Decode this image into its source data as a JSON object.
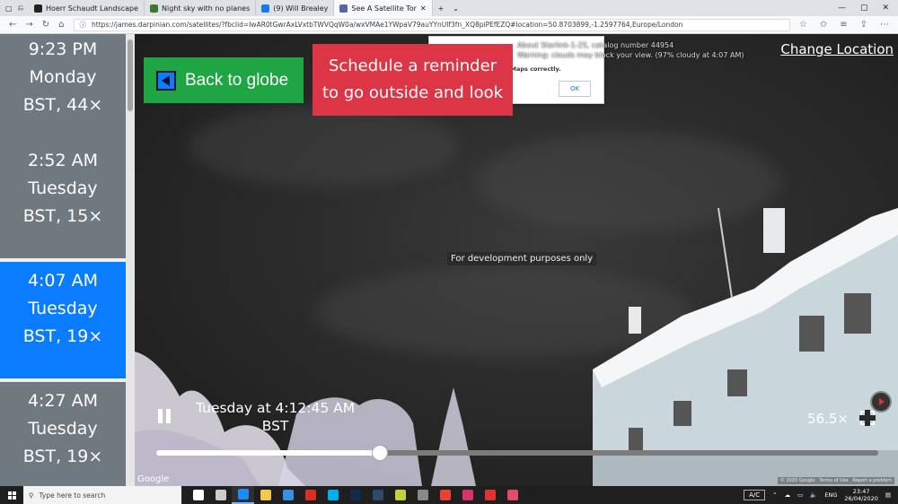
{
  "browser": {
    "tabs": [
      {
        "title": "Hoerr Schaudt Landscape",
        "color": "#222222"
      },
      {
        "title": "Night sky with no planes",
        "color": "#3a7a2a"
      },
      {
        "title": "(9) Will Brealey",
        "color": "#1877f2"
      },
      {
        "title": "See A Satellite Tor",
        "color": "#5566aa",
        "active": true
      }
    ],
    "url": "https://james.darpinian.com/satellites/?fbclid=IwAR0tGwrAxLVxtbTWVQqW0a/wxVMAe1YWpaV79auYYnUlf3fn_XQ8piPEfEZQ#location=50.8703899,-1.2597764,Europe/London"
  },
  "times": [
    {
      "time": "9:23 PM",
      "day": "Monday",
      "zone": "BST, 44×"
    },
    {
      "time": "2:52 AM",
      "day": "Tuesday",
      "zone": "BST, 15×"
    },
    {
      "time": "4:07 AM",
      "day": "Tuesday",
      "zone": "BST, 19×",
      "selected": true
    },
    {
      "time": "4:27 AM",
      "day": "Tuesday",
      "zone": "BST, 19×"
    }
  ],
  "buttons": {
    "back": "Back to globe",
    "remind_line1": "Schedule a reminder",
    "remind_line2": "to go outside and look",
    "change_location": "Change Location"
  },
  "satellite_info": {
    "line1": "About Starlink-1-25, catalog number 44954",
    "line2": "Warning: clouds may block your view. (97% cloudy at 4:07 AM)"
  },
  "dialog": {
    "message": "gle Maps correctly.",
    "ok_label": "OK"
  },
  "sky": {
    "dev_label": "For development purposes only"
  },
  "playback": {
    "time_line1": "Tuesday at 4:12:45 AM",
    "time_line2": "BST",
    "zoom": "56.5×",
    "progress": 0.31
  },
  "map_footer": {
    "google": "Google",
    "copyright": "© 2020 Google",
    "terms": "Terms of Use",
    "report": "Report a problem"
  },
  "taskbar": {
    "search_placeholder": "Type here to search",
    "ac": "A/C",
    "lang": "ENG",
    "time": "23:47",
    "date": "26/04/2020",
    "apps": [
      {
        "name": "task-view",
        "color": "#ffffff"
      },
      {
        "name": "multitask",
        "color": "#cccccc"
      },
      {
        "name": "edge",
        "color": "#1a8cff",
        "active": true
      },
      {
        "name": "files",
        "color": "#f2c94c"
      },
      {
        "name": "mail",
        "color": "#3a8ee6"
      },
      {
        "name": "autocad",
        "color": "#d93025"
      },
      {
        "name": "skype",
        "color": "#00aff0"
      },
      {
        "name": "photoshop",
        "color": "#0f2c4c"
      },
      {
        "name": "lightroom",
        "color": "#2d4a6b"
      },
      {
        "name": "stack",
        "color": "#c5d13a"
      },
      {
        "name": "calculator",
        "color": "#888888"
      },
      {
        "name": "chrome",
        "color": "#e94335"
      },
      {
        "name": "indesign",
        "color": "#d6336c"
      },
      {
        "name": "acrobat",
        "color": "#e03131"
      },
      {
        "name": "drop",
        "color": "#e34b6a"
      }
    ]
  }
}
